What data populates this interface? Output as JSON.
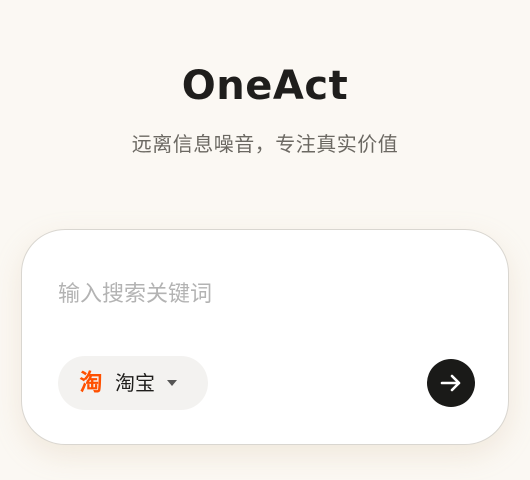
{
  "header": {
    "title": "OneAct",
    "subtitle": "远离信息噪音，专注真实价值"
  },
  "search": {
    "placeholder": "输入搜索关键词",
    "value": ""
  },
  "platform": {
    "icon_glyph": "淘",
    "icon_name": "taobao-icon",
    "label": "淘宝",
    "dropdown_icon": "chevron-down-icon"
  },
  "submit": {
    "icon_name": "arrow-right-icon"
  },
  "colors": {
    "background": "#fbf8f3",
    "brand_taobao": "#ff5000",
    "submit_bg": "#1a1a18",
    "text_primary": "#1f1e1c",
    "text_secondary": "#6b6862",
    "placeholder": "#b3b3b3"
  }
}
